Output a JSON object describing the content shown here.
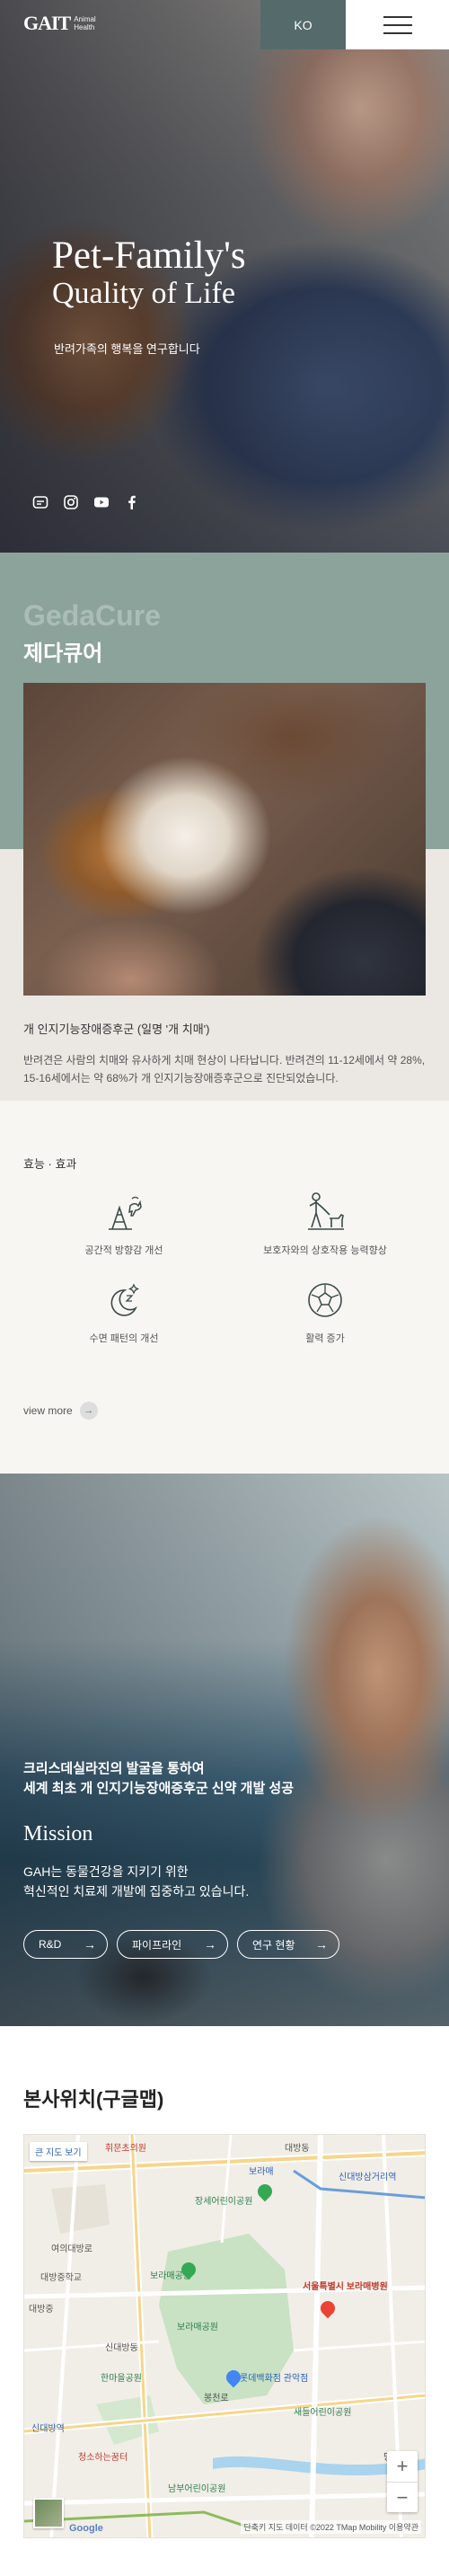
{
  "header": {
    "logo_mark": "GAIT",
    "logo_sub_1": "Animal",
    "logo_sub_2": "Health",
    "lang": "KO",
    "menu_icon": "hamburger-menu-icon"
  },
  "hero": {
    "title_line1": "Pet-Family's",
    "title_line2": "Quality of Life",
    "subtitle": "반려가족의 행복을 연구합니다",
    "social": [
      "blog-icon",
      "instagram-icon",
      "youtube-icon",
      "facebook-icon"
    ]
  },
  "gedacure": {
    "title_en": "GedaCure",
    "title_ko": "제다큐어",
    "desc_title": "개 인지기능장애증후군 (일명 '개 치매')",
    "desc_body": "반려견은 사람의 치매와 유사하게 치매 현상이 나타납니다. 반려견의 11-12세에서 약 28%, 15-16세에서는 약 68%가 개 인지기능장애증후군으로 진단되었습니다.",
    "effects_title": "효능 · 효과",
    "effects": [
      {
        "label": "공간적 방향감 개선",
        "icon": "agility-cone-icon"
      },
      {
        "label": "보호자와의 상호작용 능력향상",
        "icon": "person-walking-dog-icon"
      },
      {
        "label": "수면 패턴의 개선",
        "icon": "moon-stars-icon"
      },
      {
        "label": "활력 증가",
        "icon": "ball-icon"
      }
    ],
    "view_more": "view more"
  },
  "mission": {
    "lead_line1": "크리스데실라진의 발굴을 통하여",
    "lead_line2": "세계 최초 개 인지기능장애증후군 신약 개발 성공",
    "title": "Mission",
    "text_line1": "GAH는 동물건강을 지키기 위한",
    "text_line2": "혁신적인 치료제 개발에 집중하고 있습니다.",
    "buttons": [
      "R&D",
      "파이프라인",
      "연구 현황"
    ]
  },
  "map": {
    "title": "본사위치(구글맵)",
    "labels": {
      "l1": "큰 지도 보기",
      "l2": "휘문초의원",
      "l3": "대방동",
      "l4": "보라매",
      "l5": "신대방삼거리역",
      "l6": "장세어린이공원",
      "l7": "여의대방로",
      "l8": "대방중학교",
      "l9": "보라매공원",
      "l10": "서울특별시 보라매병원",
      "l11": "대방중",
      "l12": "보라매공원",
      "l13": "신대방동",
      "l14": "한마을공원",
      "l15": "롯데백화점 관악점",
      "l16": "봉천로",
      "l17": "새들어린이공원",
      "l18": "신대방역",
      "l19": "청소하는꿈터",
      "l20": "남부어린이공원",
      "l21": "당곡"
    },
    "zoom_in": "+",
    "zoom_out": "−",
    "google": "Google",
    "footer": "단축키  지도 데이터 ©2022 TMap Mobility  이용약관"
  }
}
